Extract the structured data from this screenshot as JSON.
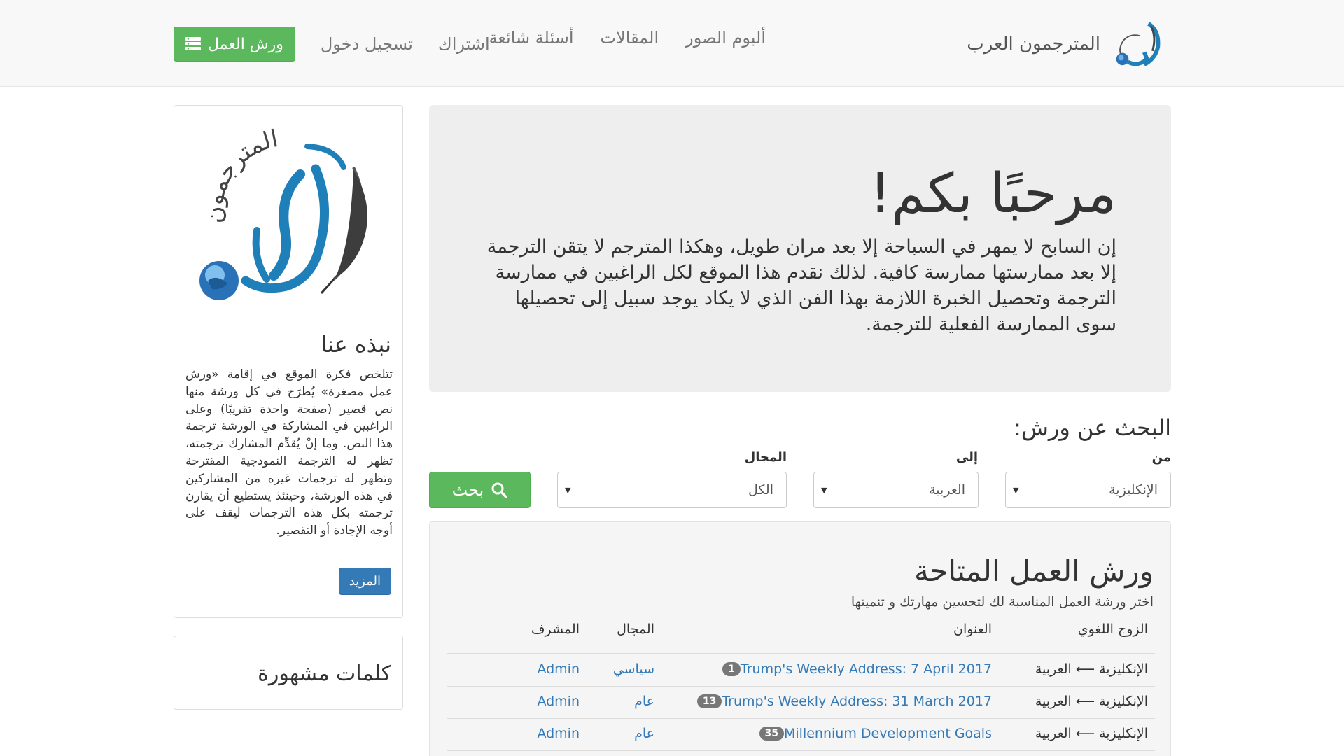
{
  "navbar": {
    "brand": "المترجمون العرب",
    "links": [
      "ألبوم الصور",
      "المقالات",
      "أسئلة شائعة"
    ],
    "signup": "اشتراك",
    "login": "تسجيل دخول",
    "workshops_btn": "ورش العمل"
  },
  "sidebar": {
    "logo_text": "المترجمون",
    "about_title": "نبذه عنا",
    "about_text": "تتلخص فكرة الموقع في إقامة «ورش عمل مصغرة» يُطرَح في كل ورشة منها نص قصير (صفحة واحدة تقريبًا) وعلى الراغبين في المشاركة في الورشة ترجمة هذا النص. وما إنْ يُقدِّم المشارك ترجمته، تظهر له الترجمة النموذجية المقترحة وتظهر له ترجمات غيره من المشاركين في هذه الورشة، وحينئذ يستطيع أن يقارن ترجمته بكل هذه الترجمات ليقف على أوجه الإجادة أو التقصير.",
    "more_btn": "المزيد",
    "tags_title": "كلمات مشهورة"
  },
  "jumbotron": {
    "title": "مرحبًا بكم!",
    "text": "إن السابح لا يمهر في السباحة إلا بعد مران طويل، وهكذا المترجم لا يتقن الترجمة إلا بعد ممارستها ممارسة كافية. لذلك نقدم هذا الموقع لكل الراغبين في ممارسة الترجمة وتحصيل الخبرة اللازمة بهذا الفن الذي لا يكاد يوجد سبيل إلى تحصيلها سوى الممارسة الفعلية للترجمة."
  },
  "search": {
    "title": "البحث عن ورش:",
    "from_label": "من",
    "from_value": "الإنكليزية",
    "to_label": "إلى",
    "to_value": "العربية",
    "field_label": "المجال",
    "field_value": "الكل",
    "button": "بحث"
  },
  "workshops": {
    "title": "ورش العمل المتاحة",
    "subtitle": "اختر ورشة العمل المناسبة لك لتحسين مهارتك و تنميتها",
    "headers": {
      "pair": "الزوج اللغوي",
      "title": "العنوان",
      "field": "المجال",
      "supervisor": "المشرف"
    },
    "rows": [
      {
        "pair": "الإنكليزية ⟵ العربية",
        "count": "1",
        "title": "Trump's Weekly Address: 7 April 2017",
        "field": "سياسي",
        "supervisor": "Admin"
      },
      {
        "pair": "الإنكليزية ⟵ العربية",
        "count": "13",
        "title": "Trump's Weekly Address: 31 March 2017",
        "field": "عام",
        "supervisor": "Admin"
      },
      {
        "pair": "الإنكليزية ⟵ العربية",
        "count": "35",
        "title": "Millennium Development Goals",
        "field": "عام",
        "supervisor": "Admin"
      }
    ]
  },
  "colors": {
    "success": "#5cb85c",
    "primary": "#337ab7",
    "logo_blue": "#1f7fb8"
  }
}
